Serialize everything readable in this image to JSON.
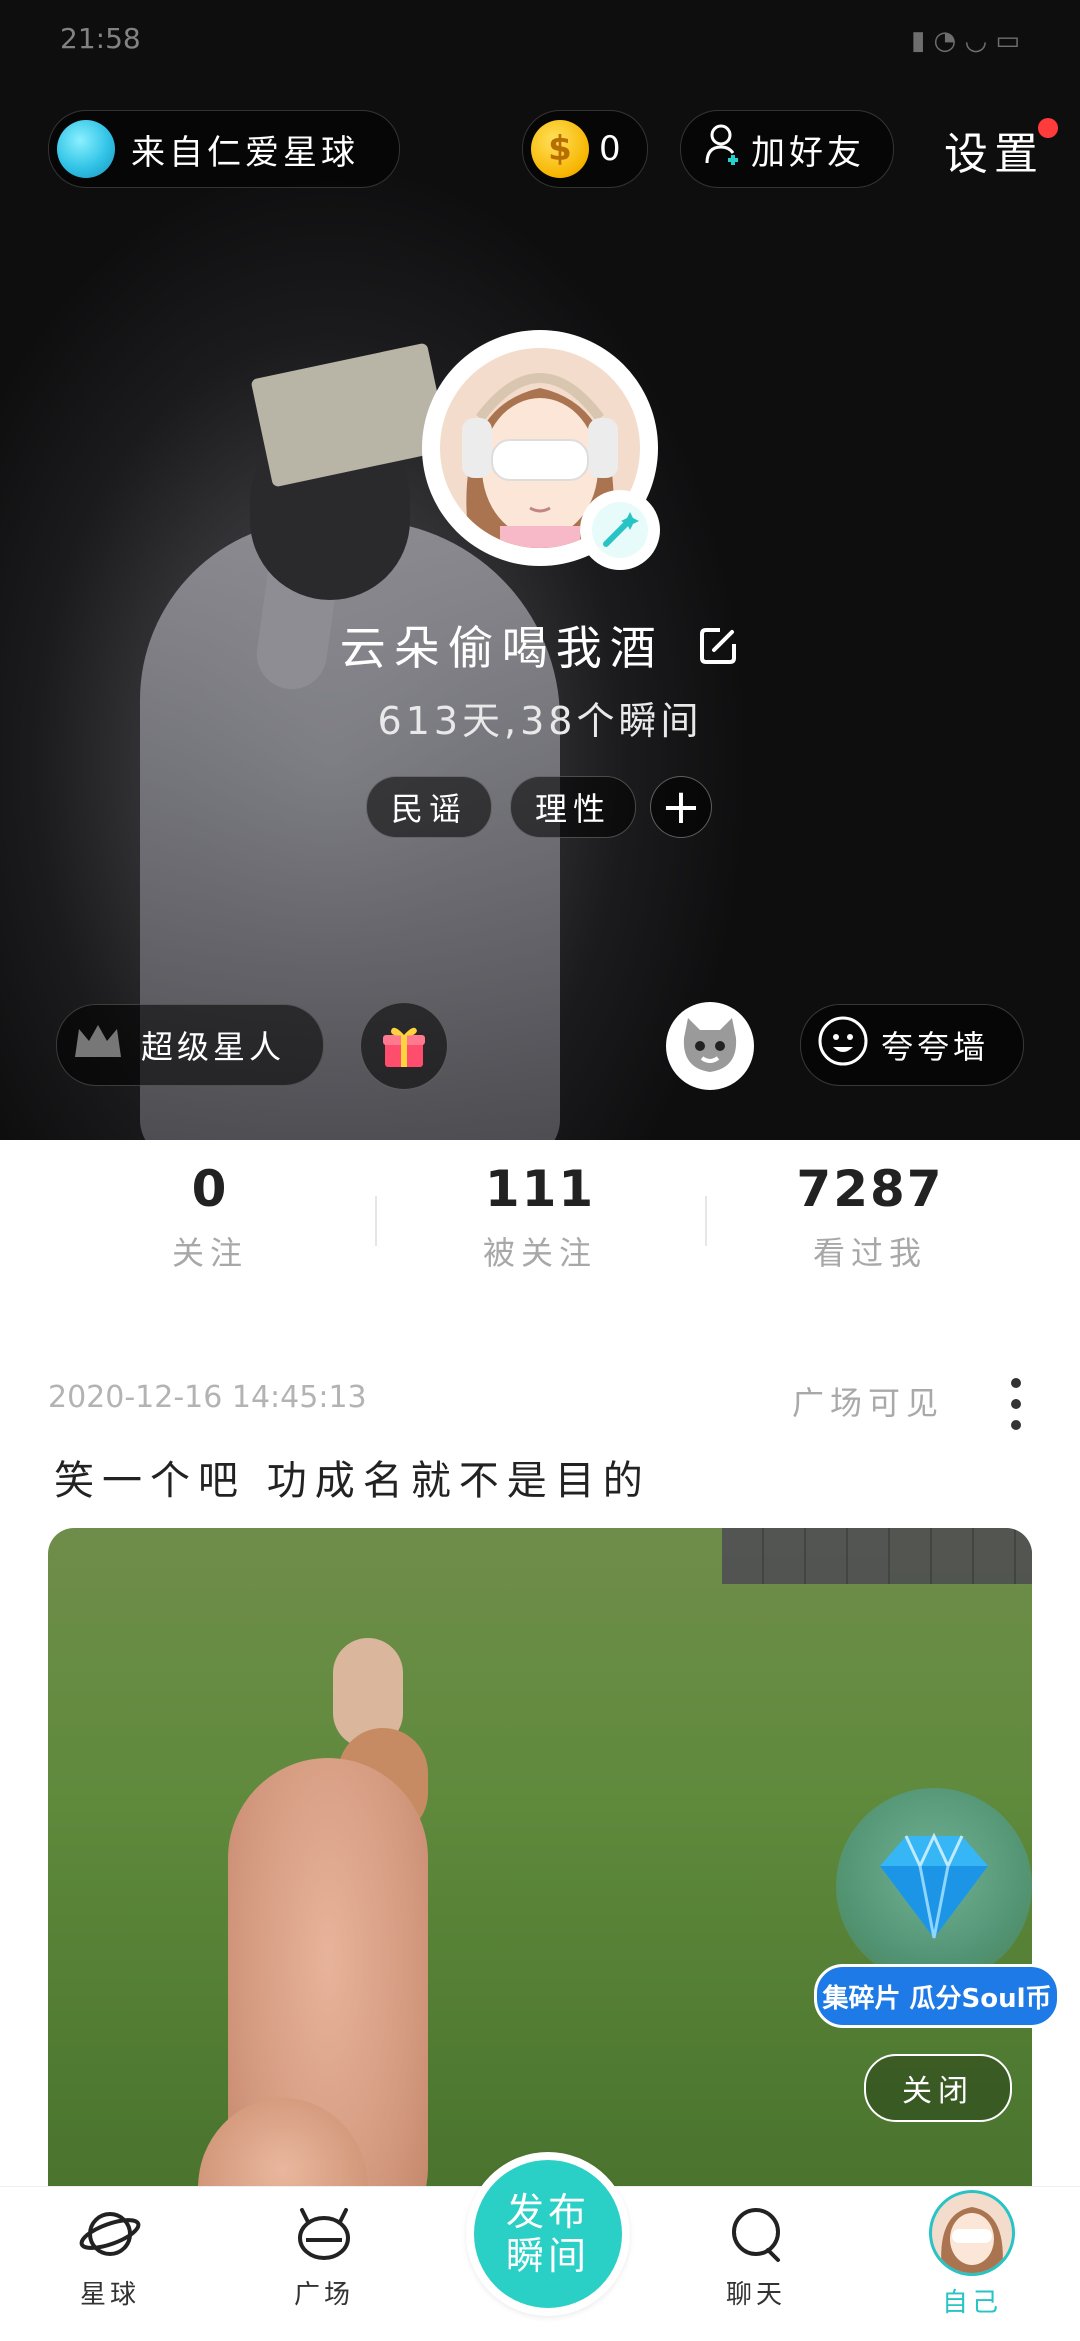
{
  "status_bar": {
    "time": "21:58"
  },
  "header": {
    "origin_label": "来自仁爱星球",
    "coins": "0",
    "coin_symbol": "$",
    "add_friend_label": "加好友",
    "settings_label": "设置"
  },
  "profile": {
    "name": "云朵偷喝我酒",
    "days_moments": "613天,38个瞬间",
    "tags": [
      "民谣",
      "理性"
    ],
    "add_tag": "+"
  },
  "actions": {
    "super_star_label": "超级星人",
    "praise_wall_label": "夸夸墙"
  },
  "stats": [
    {
      "value": "0",
      "label": "关注"
    },
    {
      "value": "111",
      "label": "被关注"
    },
    {
      "value": "7287",
      "label": "看过我"
    }
  ],
  "post": {
    "date": "2020-12-16 14:45:13",
    "visibility": "广场可见",
    "text": "笑一个吧  功成名就不是目的"
  },
  "promo": {
    "banner": "集碎片 瓜分Soul币",
    "close_label": "关闭"
  },
  "tabbar": {
    "items": [
      {
        "label": "星球"
      },
      {
        "label": "广场"
      },
      {
        "label": "聊天"
      },
      {
        "label": "自己"
      }
    ],
    "publish_line1": "发布",
    "publish_line2": "瞬间"
  },
  "colors": {
    "accent": "#27c3c5",
    "publish": "#2ad0c6",
    "notify": "#ff3b3b"
  }
}
